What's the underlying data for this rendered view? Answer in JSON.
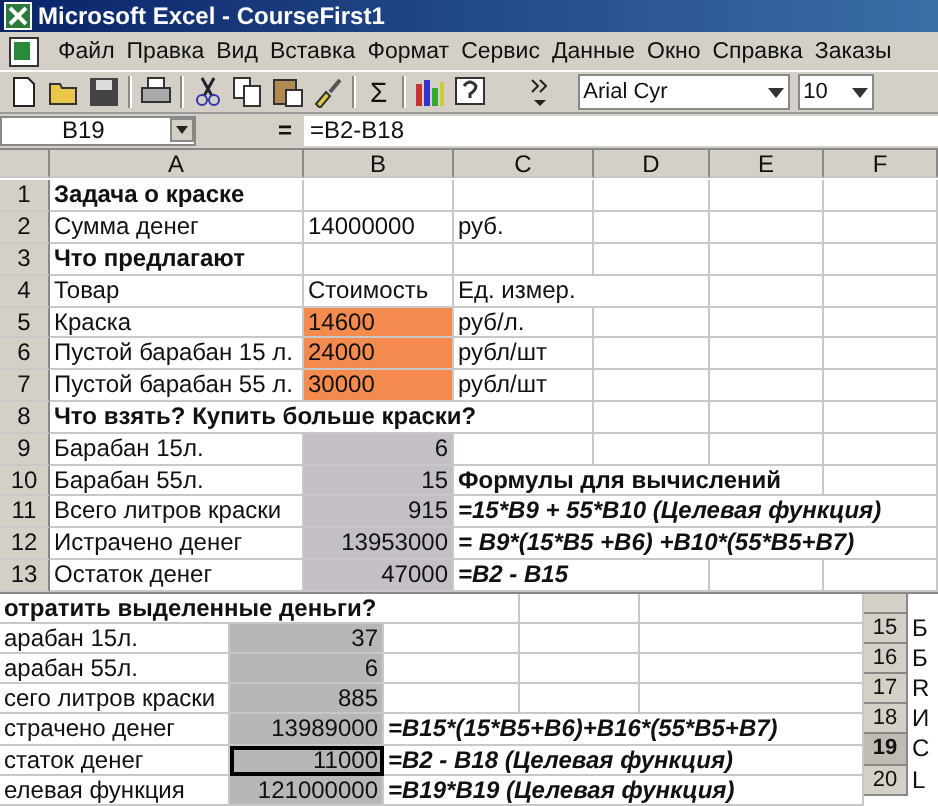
{
  "window": {
    "title": "Microsoft Excel - CourseFirst1"
  },
  "menu": [
    "Файл",
    "Правка",
    "Вид",
    "Вставка",
    "Формат",
    "Сервис",
    "Данные",
    "Окно",
    "Справка",
    "Заказы"
  ],
  "toolbar": {
    "autosum": "Σ",
    "font": "Arial Cyr",
    "size": "10"
  },
  "formula_bar": {
    "cell": "B19",
    "equals": "=",
    "formula": "=B2-B18"
  },
  "columns": [
    "A",
    "B",
    "C",
    "D",
    "E",
    "F"
  ],
  "rows": [
    {
      "num": "1",
      "cells": [
        {
          "text": "Задача о краске",
          "kind": "title"
        }
      ]
    },
    {
      "num": "2",
      "cells": [
        {
          "text": "Сумма денег",
          "kind": "plain"
        },
        {
          "text": "14000000",
          "kind": "plain"
        },
        {
          "text": "руб.",
          "kind": "plain"
        }
      ]
    },
    {
      "num": "3",
      "cells": [
        {
          "text": "Что предлагают",
          "kind": "title"
        }
      ]
    },
    {
      "num": "4",
      "cells": [
        {
          "text": "Товар",
          "kind": "plain"
        },
        {
          "text": "Стоимость",
          "kind": "plain"
        },
        {
          "text": "Ед. измер.",
          "kind": "plain"
        }
      ]
    },
    {
      "num": "5",
      "cells": [
        {
          "text": "Краска",
          "kind": "plain"
        },
        {
          "text": "14600",
          "kind": "input"
        },
        {
          "text": "руб/л.",
          "kind": "plain"
        }
      ]
    },
    {
      "num": "6",
      "cells": [
        {
          "text": "Пустой барабан 15 л.",
          "kind": "plain"
        },
        {
          "text": "24000",
          "kind": "input"
        },
        {
          "text": "рубл/шт",
          "kind": "plain"
        }
      ]
    },
    {
      "num": "7",
      "cells": [
        {
          "text": "Пустой барабан 55 л.",
          "kind": "plain"
        },
        {
          "text": "30000",
          "kind": "input"
        },
        {
          "text": "рубл/шт",
          "kind": "plain"
        }
      ]
    },
    {
      "num": "8",
      "cells": [
        {
          "text": "Что взять? Купить больше краски?",
          "kind": "title"
        }
      ]
    },
    {
      "num": "9",
      "cells": [
        {
          "text": "Барабан 15л.",
          "kind": "plain"
        },
        {
          "text": "6",
          "kind": "variable"
        }
      ]
    },
    {
      "num": "10",
      "cells": [
        {
          "text": "Барабан 55л.",
          "kind": "plain"
        },
        {
          "text": "15",
          "kind": "variable"
        },
        {
          "text": "Формулы для вычислений",
          "kind": "title"
        }
      ]
    },
    {
      "num": "11",
      "cells": [
        {
          "text": "Всего литров краски",
          "kind": "plain"
        },
        {
          "text": "915",
          "kind": "variable"
        },
        {
          "text": "=15*B9 + 55*B10 (Целевая функция)",
          "kind": "formula"
        }
      ]
    },
    {
      "num": "12",
      "cells": [
        {
          "text": "Истрачено денег",
          "kind": "plain"
        },
        {
          "text": "13953000",
          "kind": "variable"
        },
        {
          "text": "= B9*(15*B5 +B6) +B10*(55*B5+B7)",
          "kind": "formula"
        }
      ]
    },
    {
      "num": "13",
      "cells": [
        {
          "text": "Остаток денег",
          "kind": "plain"
        },
        {
          "text": "47000",
          "kind": "variable"
        },
        {
          "text": "=B2 - B15",
          "kind": "formula"
        }
      ]
    }
  ],
  "second_sheet": {
    "rows": [
      {
        "cells": [
          {
            "text": "отратить выделенные деньги?",
            "kind": "title",
            "selected": false
          }
        ]
      },
      {
        "cells": [
          {
            "text": "арабан 15л.",
            "kind": "plain",
            "selected": false
          },
          {
            "text": "37",
            "kind": "variable",
            "selected": false
          }
        ]
      },
      {
        "cells": [
          {
            "text": "арабан 55л.",
            "kind": "plain",
            "selected": false
          },
          {
            "text": "6",
            "kind": "variable",
            "selected": false
          }
        ]
      },
      {
        "cells": [
          {
            "text": "сего литров краски",
            "kind": "plain",
            "selected": false
          },
          {
            "text": "885",
            "kind": "variable",
            "selected": false
          }
        ]
      },
      {
        "cells": [
          {
            "text": "страчено денег",
            "kind": "plain",
            "selected": false
          },
          {
            "text": "13989000",
            "kind": "variable",
            "selected": false
          },
          {
            "text": "=B15*(15*B5+B6)+B16*(55*B5+B7)",
            "kind": "formula",
            "selected": false
          }
        ]
      },
      {
        "cells": [
          {
            "text": "статок денег",
            "kind": "plain",
            "selected": false
          },
          {
            "text": "11000",
            "kind": "variable",
            "selected": true
          },
          {
            "text": "=B2 - B18   (Целевая функция)",
            "kind": "formula",
            "selected": false
          }
        ]
      },
      {
        "cells": [
          {
            "text": "елевая функция",
            "kind": "plain",
            "selected": false
          },
          {
            "text": "121000000",
            "kind": "variable",
            "selected": false
          },
          {
            "text": "=B19*B19 (Целевая функция)",
            "kind": "formula",
            "selected": false
          }
        ]
      }
    ],
    "side_rows": [
      {
        "num": "15",
        "text": "Б",
        "selected": false
      },
      {
        "num": "16",
        "text": "Б",
        "selected": false
      },
      {
        "num": "17",
        "text": "R",
        "selected": false
      },
      {
        "num": "18",
        "text": "И",
        "selected": false
      },
      {
        "num": "19",
        "text": "С",
        "selected": true
      },
      {
        "num": "20",
        "text": "L",
        "selected": false
      }
    ]
  }
}
